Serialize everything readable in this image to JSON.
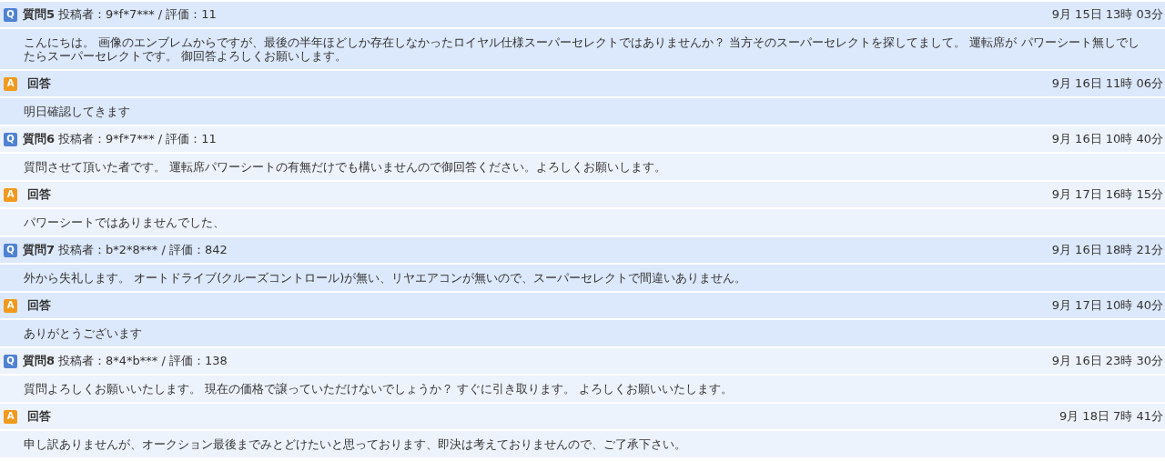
{
  "threads": [
    {
      "highlighted": true,
      "posts": [
        {
          "kind": "question",
          "badge": "Q",
          "title": "質問5",
          "meta": "投稿者：9*f*7*** / 評価：11",
          "date": "9月 15日 13時 03分",
          "body": "こんにちは。 画像のエンブレムからですが、最後の半年ほどしか存在しなかったロイヤル仕様スーパーセレクトではありませんか？ 当方そのスーパーセレクトを探してまして。 運転席が パワーシート無しでしたらスーパーセレクトです。 御回答よろしくお願いします。"
        },
        {
          "kind": "answer",
          "badge": "A",
          "title": "回答",
          "date": "9月 16日 11時 06分",
          "body": "明日確認してきます"
        }
      ]
    },
    {
      "highlighted": false,
      "posts": [
        {
          "kind": "question",
          "badge": "Q",
          "title": "質問6",
          "meta": "投稿者：9*f*7*** / 評価：11",
          "date": "9月 16日 10時 40分",
          "body": "質問させて頂いた者です。 運転席パワーシートの有無だけでも構いませんので御回答ください。よろしくお願いします。"
        },
        {
          "kind": "answer",
          "badge": "A",
          "title": "回答",
          "date": "9月 17日 16時 15分",
          "body": "パワーシートではありませんでした、"
        }
      ]
    },
    {
      "highlighted": true,
      "posts": [
        {
          "kind": "question",
          "badge": "Q",
          "title": "質問7",
          "meta": "投稿者：b*2*8*** / 評価：842",
          "date": "9月 16日 18時 21分",
          "body": "外から失礼します。 オートドライブ(クルーズコントロール)が無い、リヤエアコンが無いので、スーパーセレクトで間違いありません。"
        },
        {
          "kind": "answer",
          "badge": "A",
          "title": "回答",
          "date": "9月 17日 10時 40分",
          "body": "ありがとうございます"
        }
      ]
    },
    {
      "highlighted": false,
      "posts": [
        {
          "kind": "question",
          "badge": "Q",
          "title": "質問8",
          "meta": "投稿者：8*4*b*** / 評価：138",
          "date": "9月 16日 23時 30分",
          "body": "質問よろしくお願いいたします。 現在の価格で譲っていただけないでしょうか？ すぐに引き取ります。 よろしくお願いいたします。"
        },
        {
          "kind": "answer",
          "badge": "A",
          "title": "回答",
          "date": "9月 18日 7時 41分",
          "body": "申し訳ありませんが、オークション最後までみとどけたいと思っております、即決は考えておりませんので、ご了承下さい。"
        }
      ]
    }
  ]
}
